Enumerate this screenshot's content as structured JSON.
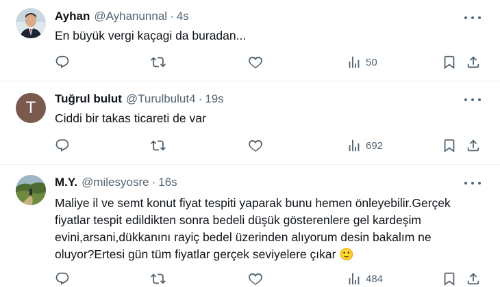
{
  "tweets": [
    {
      "name": "Ayhan",
      "handle": "@Ayhanunnal",
      "dot": "·",
      "time": "4s",
      "text": "En büyük vergi kaçagi da buradan...",
      "avatar_letter": "",
      "views": "50"
    },
    {
      "name": "Tuğrul bulut",
      "handle": "@Turulbulut4",
      "dot": "·",
      "time": "19s",
      "text": "Ciddi bir takas ticareti de var",
      "avatar_letter": "T",
      "views": "692"
    },
    {
      "name": "M.Y.",
      "handle": "@milesyosre",
      "dot": "·",
      "time": "16s",
      "text": "Maliye il ve semt konut fiyat tespiti yaparak bunu hemen önleyebilir.Gerçek fiyatlar tespit edildikten sonra bedeli düşük gösterenlere gel kardeşim evini,arsani,dükkanını rayiç bedel üzerinden alıyorum desin bakalım ne oluyor?Ertesi gün tüm fiyatlar gerçek seviyelere çıkar 🙂",
      "avatar_letter": "",
      "views": "484"
    }
  ],
  "colors": {
    "text": "#0f1419",
    "secondary": "#536471",
    "divider": "#eff3f4",
    "avatar_t": "#7a5a4e"
  },
  "icons": [
    "reply-icon",
    "retweet-icon",
    "like-icon",
    "views-icon",
    "bookmark-icon",
    "share-icon",
    "more-icon"
  ]
}
